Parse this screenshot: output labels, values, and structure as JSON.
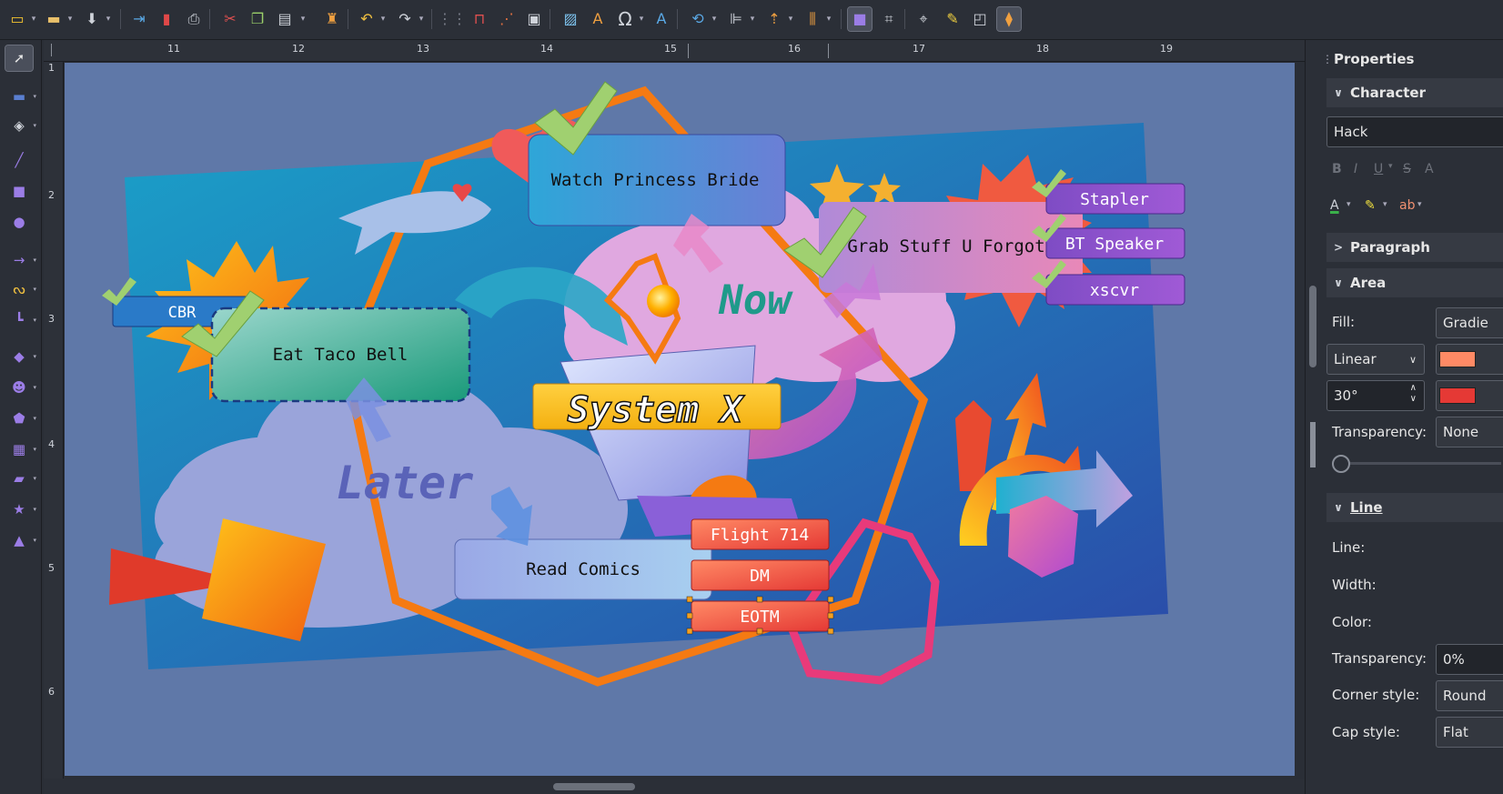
{
  "toolbar": {
    "icons": [
      "new-document-icon",
      "open-icon",
      "save-icon",
      "export-icon",
      "export-pdf-icon",
      "print-icon",
      "cut-icon",
      "copy-icon",
      "paste-icon",
      "clone-formatting-icon",
      "undo-icon",
      "redo-icon",
      "grid-icon",
      "snap-guide-icon",
      "helplines-icon",
      "display-grid-icon",
      "image-icon",
      "fontwork-icon",
      "special-character-icon",
      "text-icon",
      "transform-icon",
      "align-icon",
      "arrange-icon",
      "distribute-icon",
      "shadow-icon",
      "crop-icon",
      "points-icon",
      "highlight-icon",
      "glue-points-icon",
      "extrusion-icon"
    ]
  },
  "left_tools": [
    "select-icon",
    "line-color-icon",
    "fill-color-icon",
    "line-icon",
    "rectangle-icon",
    "ellipse-icon",
    "arrow-line-icon",
    "curve-icon",
    "connector-icon",
    "basic-shapes-icon",
    "symbol-shapes-icon",
    "block-arrows-icon",
    "flowchart-icon",
    "callout-icon",
    "stars-icon",
    "3d-objects-icon"
  ],
  "ruler": {
    "h_labels": [
      "11",
      "12",
      "13",
      "14",
      "15",
      "16",
      "17",
      "18",
      "19"
    ],
    "v_labels": [
      "1",
      "2",
      "3",
      "4",
      "5",
      "6"
    ]
  },
  "canvas": {
    "labels": {
      "watch": "Watch Princess Bride",
      "grab": "Grab Stuff U Forgot",
      "stapler": "Stapler",
      "bt": "BT Speaker",
      "xscvr": "xscvr",
      "cbr": "CBR",
      "taco": "Eat Taco Bell",
      "comics": "Read Comics",
      "flight": "Flight 714",
      "dm": "DM",
      "eotm": "EOTM",
      "now": "Now",
      "later": "Later",
      "system_x": "System X"
    },
    "colors": {
      "background": "#5f78a8",
      "frame_orange": "#f57a12",
      "label_red": "#e8473f",
      "label_purple": "#8f4fc9",
      "now_teal": "#1f9a8a",
      "later_blue": "#5a63b8"
    }
  },
  "sidebar": {
    "title": "Properties",
    "character_header": "Character",
    "font_name": "Hack",
    "paragraph_header": "Paragraph",
    "area_header": "Area",
    "fill_label": "Fill:",
    "fill_value": "Gradie",
    "gradient_type": "Linear",
    "angle_value": "30°",
    "from_color": "#ff8a65",
    "to_color": "#e53935",
    "area_transparency_label": "Transparency:",
    "area_transparency_value": "None",
    "line_header": "Line",
    "line_label": "Line:",
    "width_label": "Width:",
    "color_label": "Color:",
    "line_transparency_label": "Transparency:",
    "line_transparency_value": "0%",
    "corner_label": "Corner style:",
    "corner_value": "Round",
    "cap_label": "Cap style:",
    "cap_value": "Flat"
  }
}
